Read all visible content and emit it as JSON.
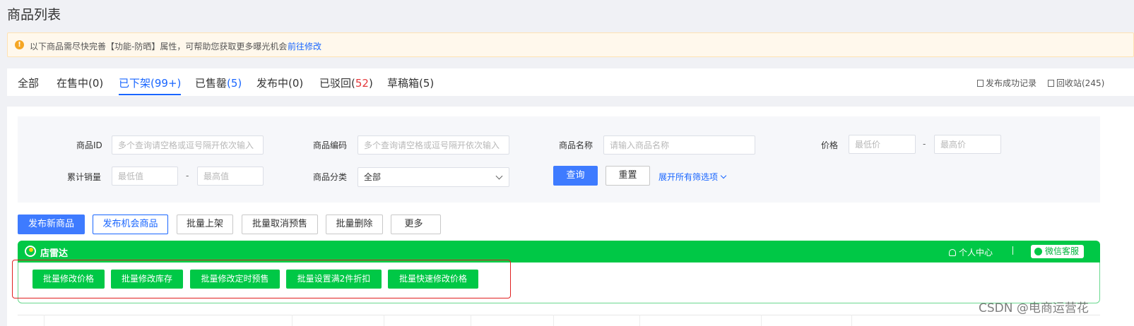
{
  "page": {
    "title": "商品列表"
  },
  "notice": {
    "text": "以下商品需尽快完善【功能-防晒】属性，可帮助您获取更多曝光机会",
    "link": "前往修改"
  },
  "tabs": [
    {
      "label": "全部",
      "count": ""
    },
    {
      "label": "在售中",
      "count": "(0)"
    },
    {
      "label": "已下架",
      "count": "(99+)"
    },
    {
      "label": "已售罄",
      "count": "(5)"
    },
    {
      "label": "发布中",
      "count": "(0)"
    },
    {
      "label": "已驳回",
      "count_open": "(",
      "count": "52",
      "count_close": ")"
    },
    {
      "label": "草稿箱",
      "count": "(5)"
    }
  ],
  "header_links": {
    "publish_log": "发布成功记录",
    "recycle": "回收站(245)"
  },
  "filters": {
    "product_id": {
      "label": "商品ID",
      "placeholder": "多个查询请空格或逗号隔开依次输入"
    },
    "product_code": {
      "label": "商品编码",
      "placeholder": "多个查询请空格或逗号隔开依次输入"
    },
    "product_name": {
      "label": "商品名称",
      "placeholder": "请输入商品名称"
    },
    "price": {
      "label": "价格",
      "min_placeholder": "最低价",
      "max_placeholder": "最高价"
    },
    "sales": {
      "label": "累计销量",
      "min_placeholder": "最低值",
      "max_placeholder": "最高值"
    },
    "category": {
      "label": "商品分类",
      "value": "全部"
    },
    "dash": "-",
    "query": "查询",
    "reset": "重置",
    "expand": "展开所有筛选项"
  },
  "actions": {
    "publish_new": "发布新商品",
    "publish_opportunity": "发布机会商品",
    "batch_list": "批量上架",
    "batch_cancel_presale": "批量取消预售",
    "batch_delete": "批量删除",
    "more": "更多"
  },
  "plugin": {
    "brand": "店雷达",
    "personal_center": "个人中心",
    "wechat_service": "微信客服",
    "buttons": [
      "批量修改价格",
      "批量修改库存",
      "批量修改定时预售",
      "批量设置满2件折扣",
      "批量快速修改价格"
    ]
  },
  "watermark": "CSDN @电商运营花",
  "colors": {
    "accent": "#1966ff",
    "plugin_green": "#00c846",
    "highlight_red": "#e02020"
  }
}
